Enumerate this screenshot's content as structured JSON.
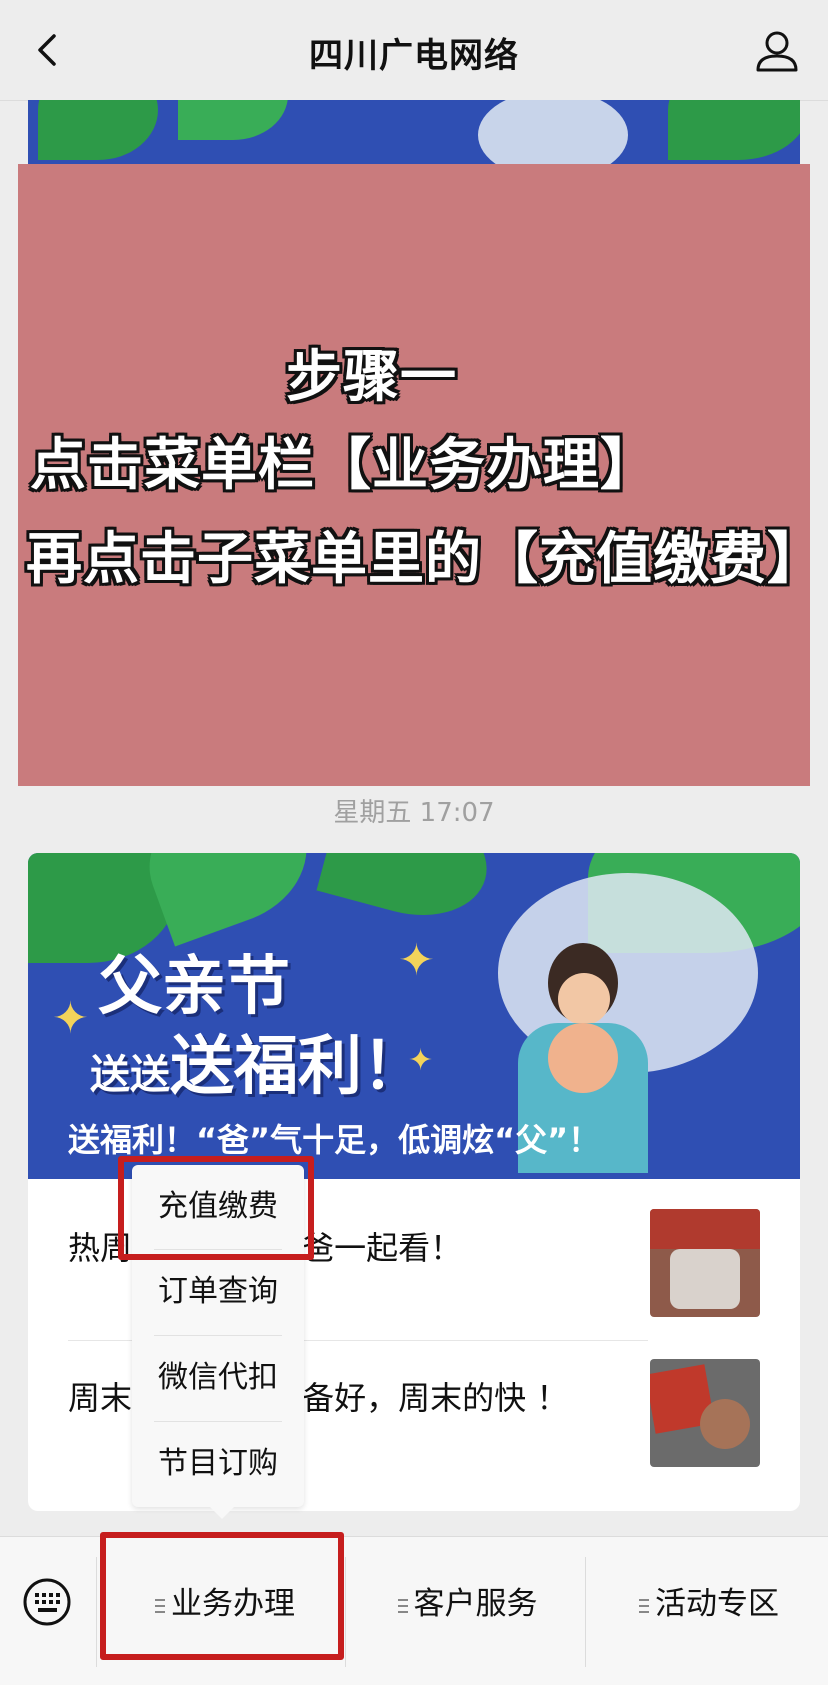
{
  "nav": {
    "title": "四川广电网络"
  },
  "overlay": {
    "line1": "步骤一",
    "line2": "点击菜单栏【业务办理】",
    "line3": "再点击子菜单里的【充值缴费】"
  },
  "timestamp": "星期五 17:07",
  "card": {
    "hero": {
      "title_line1": "父亲节",
      "title_line2_small": "送送",
      "title_line2_big": "送福利！",
      "caption": "送福利！“爸”气十足，低调炫“父”！"
    },
    "articles": [
      {
        "text": "热周 ，周末和老爸一起看！"
      },
      {
        "text": "周末 爆笑综艺已备好，周末的快 ！"
      }
    ]
  },
  "submenu": {
    "items": [
      "充值缴费",
      "订单查询",
      "微信代扣",
      "节目订购"
    ]
  },
  "bottom_menu": {
    "items": [
      "业务办理",
      "客户服务",
      "活动专区"
    ]
  },
  "colors": {
    "highlight": "#c61e1e",
    "overlay": "#c97b7d",
    "hero_bg": "#2f4fb3"
  }
}
